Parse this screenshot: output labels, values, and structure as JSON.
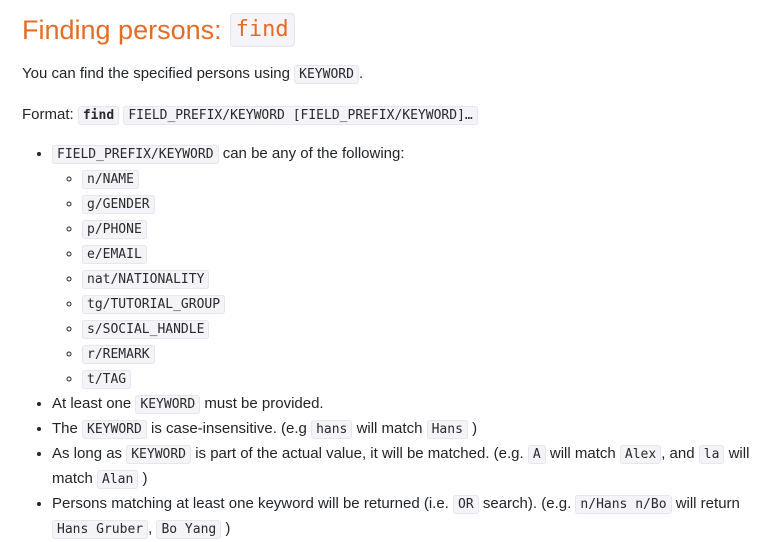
{
  "heading": {
    "text": "Finding persons:",
    "code": "find"
  },
  "intro": {
    "before": "You can find the specified persons using",
    "code": "KEYWORD",
    "after": "."
  },
  "format": {
    "label": "Format:",
    "cmd": "find",
    "args": "FIELD_PREFIX/KEYWORD [FIELD_PREFIX/KEYWORD]…"
  },
  "bullet1": {
    "code": "FIELD_PREFIX/KEYWORD",
    "text": "can be any of the following:"
  },
  "prefixes": [
    "n/NAME",
    "g/GENDER",
    "p/PHONE",
    "e/EMAIL",
    "nat/NATIONALITY",
    "tg/TUTORIAL_GROUP",
    "s/SOCIAL_HANDLE",
    "r/REMARK",
    "t/TAG"
  ],
  "bullet2": {
    "before": "At least one",
    "code": "KEYWORD",
    "after": "must be provided."
  },
  "bullet3": {
    "before": "The",
    "code": "KEYWORD",
    "mid": "is case-insensitive. (e.g",
    "code2": "hans",
    "mid2": "will match",
    "code3": "Hans",
    "after": ")"
  },
  "bullet4": {
    "before": "As long as",
    "code": "KEYWORD",
    "mid": "is part of the actual value, it will be matched. (e.g.",
    "code2": "A",
    "mid2": "will match",
    "code3": "Alex",
    "mid3": ", and",
    "code4": "la",
    "mid4": "will match",
    "code5": "Alan",
    "after": ")"
  },
  "bullet5": {
    "before": "Persons matching at least one keyword will be returned (i.e.",
    "code": "OR",
    "mid": "search). (e.g.",
    "code2": "n/Hans n/Bo",
    "mid2": "will return",
    "code3": "Hans Gruber",
    "mid3": ",",
    "code4": "Bo Yang",
    "after": ")"
  }
}
